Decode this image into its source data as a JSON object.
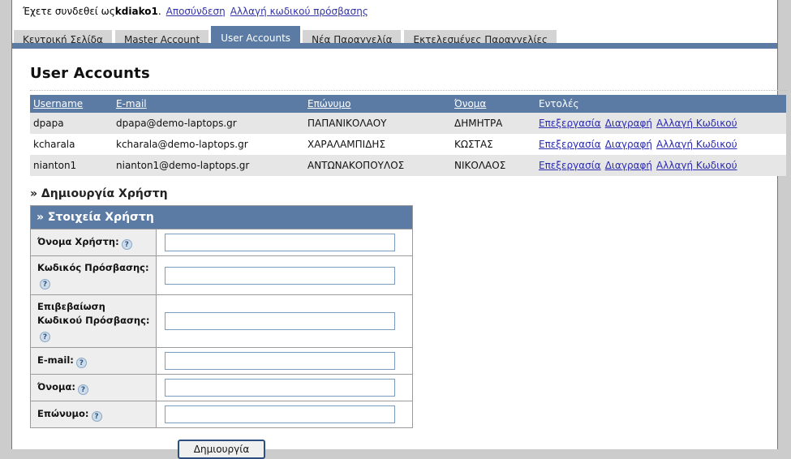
{
  "status_bar": {
    "welcome_prefix": "Έχετε συνδεθεί ως ",
    "username": "kdiako1",
    "welcome_suffix": ".",
    "logout_link": "Αποσύνδεση",
    "change_password_link": "Αλλαγή κωδικού πρόσβασης"
  },
  "tabs": [
    {
      "label": "Κεντρική Σελίδα",
      "active": false
    },
    {
      "label": "Master Account",
      "active": false
    },
    {
      "label": "User Accounts",
      "active": true
    },
    {
      "label": "Νέα Παραγγελία",
      "active": false
    },
    {
      "label": "Εκτελεσμένες Παραγγελίες",
      "active": false
    }
  ],
  "page": {
    "title": "User Accounts"
  },
  "users_table": {
    "headers": [
      "Username",
      "E-mail",
      "Επώνυμο",
      "Όνομα",
      "Εντολές"
    ],
    "header_sortable": [
      true,
      true,
      true,
      true,
      false
    ],
    "row_actions": [
      "Επεξεργασία",
      "Διαγραφή",
      "Αλλαγή Κωδικού"
    ],
    "rows": [
      {
        "username": "dpapa",
        "email": "dpapa@demo-laptops.gr",
        "lastname": "ΠΑΠΑΝΙΚΟΛΑΟΥ",
        "firstname": "ΔΗΜΗΤΡΑ"
      },
      {
        "username": "kcharala",
        "email": "kcharala@demo-laptops.gr",
        "lastname": "ΧΑΡΑΛΑΜΠΙΔΗΣ",
        "firstname": "ΚΩΣΤΑΣ"
      },
      {
        "username": "nianton1",
        "email": "nianton1@demo-laptops.gr",
        "lastname": "ΑΝΤΩΝΑΚΟΠΟΥΛΟΣ",
        "firstname": "ΝΙΚΟΛΑΟΣ"
      }
    ]
  },
  "create_user": {
    "section_heading": "» Δημιουργία Χρήστη",
    "panel_heading": "» Στοιχεία Χρήστη",
    "fields": [
      {
        "label": "Όνομα Χρήστη:",
        "value": "",
        "help_icon": "help-question-icon"
      },
      {
        "label": "Κωδικός Πρόσβασης:",
        "value": "",
        "help_icon": "help-question-icon"
      },
      {
        "label": "Επιβεβαίωση Κωδικού Πρόσβασης:",
        "value": "",
        "help_icon": "help-question-icon"
      },
      {
        "label": "E-mail:",
        "value": "",
        "help_icon": "help-question-icon"
      },
      {
        "label": "Όνομα:",
        "value": "",
        "help_icon": "help-question-icon"
      },
      {
        "label": "Επώνυμο:",
        "value": "",
        "help_icon": "help-question-icon"
      }
    ],
    "submit_label": "Δημιουργία"
  },
  "icons": {
    "help": "?"
  },
  "colors": {
    "accent_blue": "#5b7ba5",
    "link_blue": "#2b2bb0",
    "row_alt": "#e6e6e6",
    "label_bg": "#eeeeee",
    "page_bg": "#cccccc"
  }
}
